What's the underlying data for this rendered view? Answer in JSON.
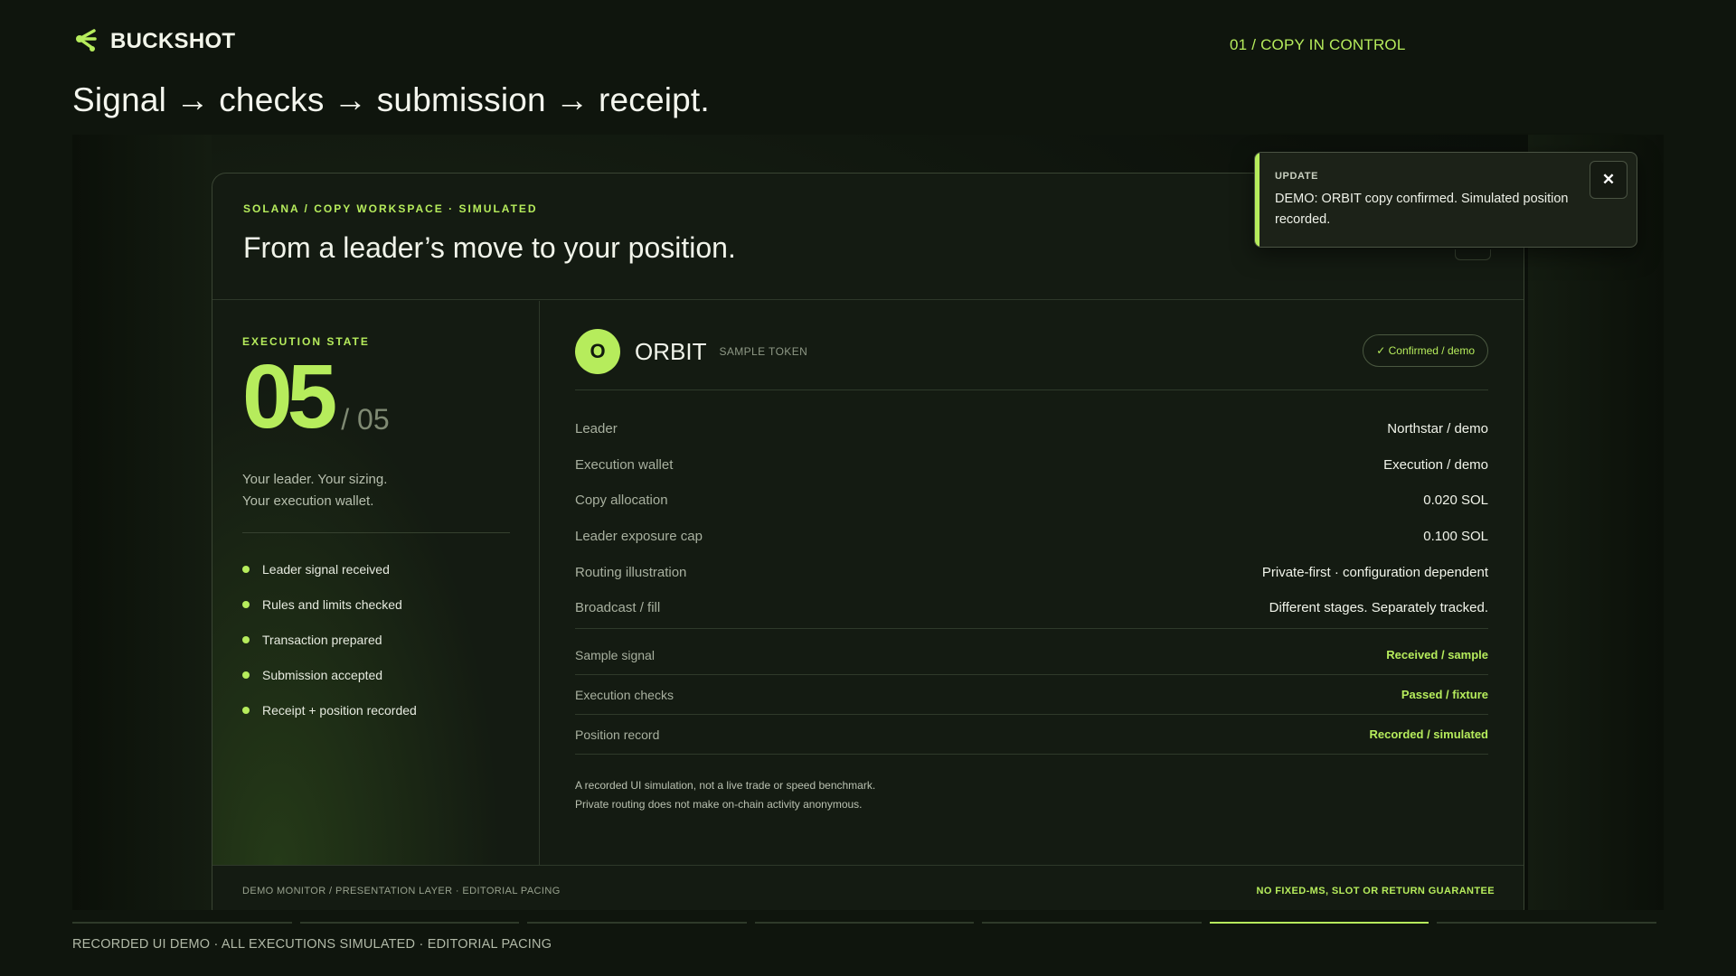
{
  "brand": {
    "name": "BUCKSHOT",
    "logo_icon": "spread-arrow-icon"
  },
  "section_tag": "01 / COPY IN CONTROL",
  "headline": "Signal → checks → submission → receipt.",
  "panel": {
    "eyebrow": "SOLANA / COPY WORKSPACE · SIMULATED",
    "title": "From a leader’s move to your position.",
    "execution": {
      "label": "EXECUTION STATE",
      "current": "05",
      "total": "/ 05",
      "desc_line1": "Your leader. Your sizing.",
      "desc_line2": "Your execution wallet.",
      "steps": [
        "Leader signal received",
        "Rules and limits checked",
        "Transaction prepared",
        "Submission accepted",
        "Receipt + position recorded"
      ]
    },
    "token": {
      "initial": "O",
      "name": "ORBIT",
      "sub": "SAMPLE TOKEN",
      "status": "✓ Confirmed / demo"
    },
    "details": [
      {
        "key": "Leader",
        "value": "Northstar / demo"
      },
      {
        "key": "Execution wallet",
        "value": "Execution / demo"
      },
      {
        "key": "Copy allocation",
        "value": "0.020 SOL"
      },
      {
        "key": "Leader exposure cap",
        "value": "0.100 SOL"
      },
      {
        "key": "Routing illustration",
        "value": "Private-first · configuration dependent"
      },
      {
        "key": "Broadcast / fill",
        "value": "Different stages. Separately tracked."
      }
    ],
    "checks": [
      {
        "key": "Sample signal",
        "value": "Received / sample"
      },
      {
        "key": "Execution checks",
        "value": "Passed / fixture"
      },
      {
        "key": "Position record",
        "value": "Recorded / simulated"
      }
    ],
    "disclaimer_line1": "A recorded UI simulation, not a live trade or speed benchmark.",
    "disclaimer_line2": "Private routing does not make on-chain activity anonymous.",
    "footer_left": "DEMO MONITOR / PRESENTATION LAYER · EDITORIAL PACING",
    "footer_right": "NO FIXED-MS, SLOT OR RETURN GUARANTEE"
  },
  "toast": {
    "label": "UPDATE",
    "message": "DEMO: ORBIT copy confirmed. Simulated position recorded.",
    "close_icon": "close-icon"
  },
  "progress": {
    "segments": 7,
    "active_index": 5
  },
  "footer_note": "RECORDED UI DEMO · ALL EXECUTIONS SIMULATED · EDITORIAL PACING",
  "colors": {
    "accent": "#b6ec5c",
    "background": "#0f150d",
    "panel": "#141b12"
  }
}
